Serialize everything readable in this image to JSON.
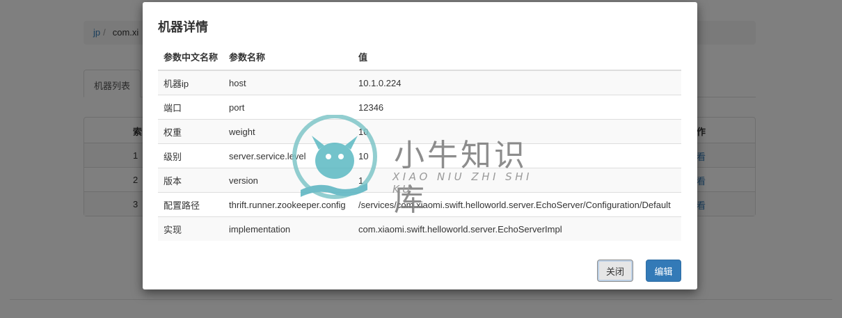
{
  "background": {
    "breadcrumb": {
      "root": "jp",
      "separator": "/",
      "current": "com.xi"
    },
    "tab_active": "机器列表",
    "table": {
      "header_col1": "索",
      "header_col2": "作",
      "rows": [
        {
          "col1": "1",
          "action": "看"
        },
        {
          "col1": "2",
          "action": "看"
        },
        {
          "col1": "3",
          "action": "看"
        }
      ]
    }
  },
  "modal": {
    "title": "机器详情",
    "columns": [
      "参数中文名称",
      "参数名称",
      "值"
    ],
    "rows": [
      {
        "cn": "机器ip",
        "name": "host",
        "value": "10.1.0.224"
      },
      {
        "cn": "端口",
        "name": "port",
        "value": "12346"
      },
      {
        "cn": "权重",
        "name": "weight",
        "value": "10"
      },
      {
        "cn": "级别",
        "name": "server.service.level",
        "value": "10"
      },
      {
        "cn": "版本",
        "name": "version",
        "value": "1"
      },
      {
        "cn": "配置路径",
        "name": "thrift.runner.zookeeper.config",
        "value": "/services/com.xiaomi.swift.helloworld.server.EchoServer/Configuration/Default"
      },
      {
        "cn": "实现",
        "name": "implementation",
        "value": "com.xiaomi.swift.helloworld.server.EchoServerImpl"
      }
    ],
    "buttons": {
      "close": "关闭",
      "edit": "编辑"
    }
  },
  "watermark": {
    "title": "小牛知识库",
    "subtitle": "XIAO NIU ZHI SHI KU",
    "logo_icon": "bull-hand-logo-icon"
  },
  "colors": {
    "primary": "#337ab7",
    "overlay": "rgba(0,0,0,0.5)"
  }
}
